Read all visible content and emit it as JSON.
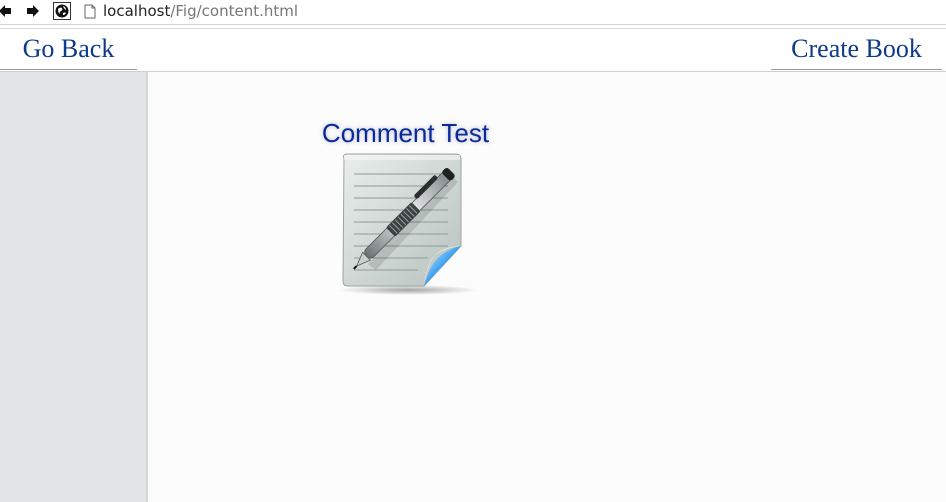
{
  "browser": {
    "url_host": "localhost",
    "url_path": "/Fig/content.html",
    "icons": {
      "back": "arrow-left-icon",
      "forward": "arrow-right-icon",
      "site": "globe-icon",
      "page": "document-icon"
    }
  },
  "header": {
    "go_back_label": "Go Back",
    "create_book_label": "Create Book",
    "link_color": "#0d3a8a"
  },
  "content": {
    "items": [
      {
        "title": "Comment Test",
        "icon": "notepad-pen-icon"
      }
    ]
  }
}
